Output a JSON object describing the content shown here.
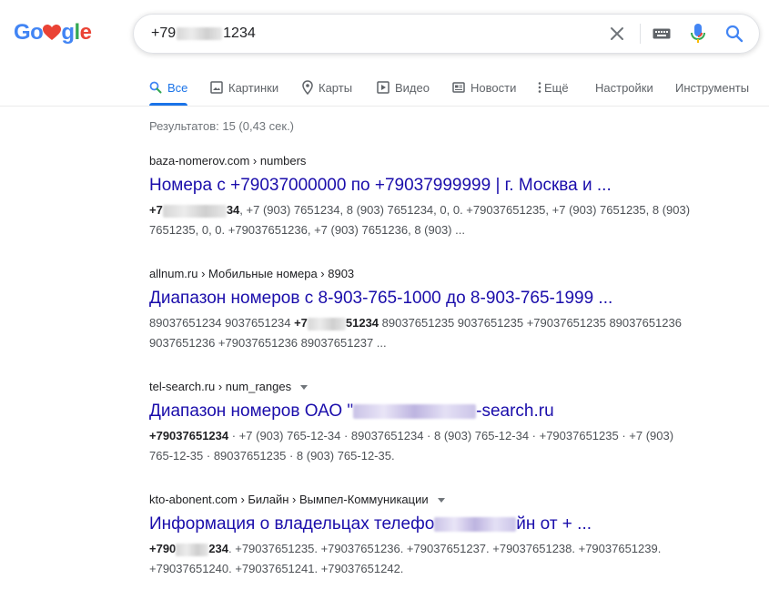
{
  "logo": {
    "text_pre": "Go",
    "text_post": "gle",
    "heart_color": "#ea4335"
  },
  "search": {
    "query_prefix": "+79",
    "query_suffix": "1234"
  },
  "tabs": [
    {
      "label": "Все",
      "icon": "search-icon",
      "active": true
    },
    {
      "label": "Картинки",
      "icon": "image-icon",
      "active": false
    },
    {
      "label": "Карты",
      "icon": "map-pin-icon",
      "active": false
    },
    {
      "label": "Видео",
      "icon": "video-icon",
      "active": false
    },
    {
      "label": "Новости",
      "icon": "news-icon",
      "active": false
    },
    {
      "label": "Ещё",
      "icon": "more-vert-icon",
      "active": false
    },
    {
      "label": "Настройки",
      "icon": "",
      "active": false
    },
    {
      "label": "Инструменты",
      "icon": "",
      "active": false
    }
  ],
  "stats": "Результатов: 15 (0,43 сек.)",
  "results": [
    {
      "crumb": "baza-nomerov.com › numbers",
      "title": "Номера с +79037000000 по +79037999999 | г. Москва и ...",
      "snippet_bold_pre": "+7",
      "snippet_bold_post": "34",
      "snippet_rest": ", +7 (903) 7651234, 8 (903) 7651234, 0, 0. +79037651235, +7 (903) 7651235, 8 (903) 7651235, 0, 0. +79037651236, +7 (903) 7651236, 8 (903) ..."
    },
    {
      "crumb": "allnum.ru › Мобильные номера › 8903",
      "title": "Диапазон номеров с 8-903-765-1000 до 8-903-765-1999 ...",
      "snippet_pre": "89037651234 9037651234 ",
      "snippet_bold_pre": "+7",
      "snippet_bold_post": "51234",
      "snippet_rest": " 89037651235 9037651235 +79037651235 89037651236 9037651236 +79037651236 89037651237 ..."
    },
    {
      "crumb": "tel-search.ru › num_ranges",
      "title_pre": "Диапазон номеров ОАО \"",
      "title_post": "-search.ru",
      "snippet_bold": "+79037651234",
      "snippet_rest": " · +7 (903) 765-12-34 · 89037651234 · 8 (903) 765-12-34 · +79037651235 · +7 (903) 765-12-35 · 89037651235 · 8 (903) 765-12-35."
    },
    {
      "crumb": "kto-abonent.com › Билайн › Вымпел-Коммуникации",
      "title_pre": "Информация о владельцах телефо",
      "title_post": "йн от + ...",
      "snippet_bold_pre": "+790",
      "snippet_bold_post": "234",
      "snippet_rest": ". +79037651235. +79037651236. +79037651237. +79037651238. +79037651239. +79037651240. +79037651241. +79037651242."
    }
  ],
  "colors": {
    "link": "#1a0dab",
    "accent": "#1a73e8",
    "muted": "#70757a"
  }
}
